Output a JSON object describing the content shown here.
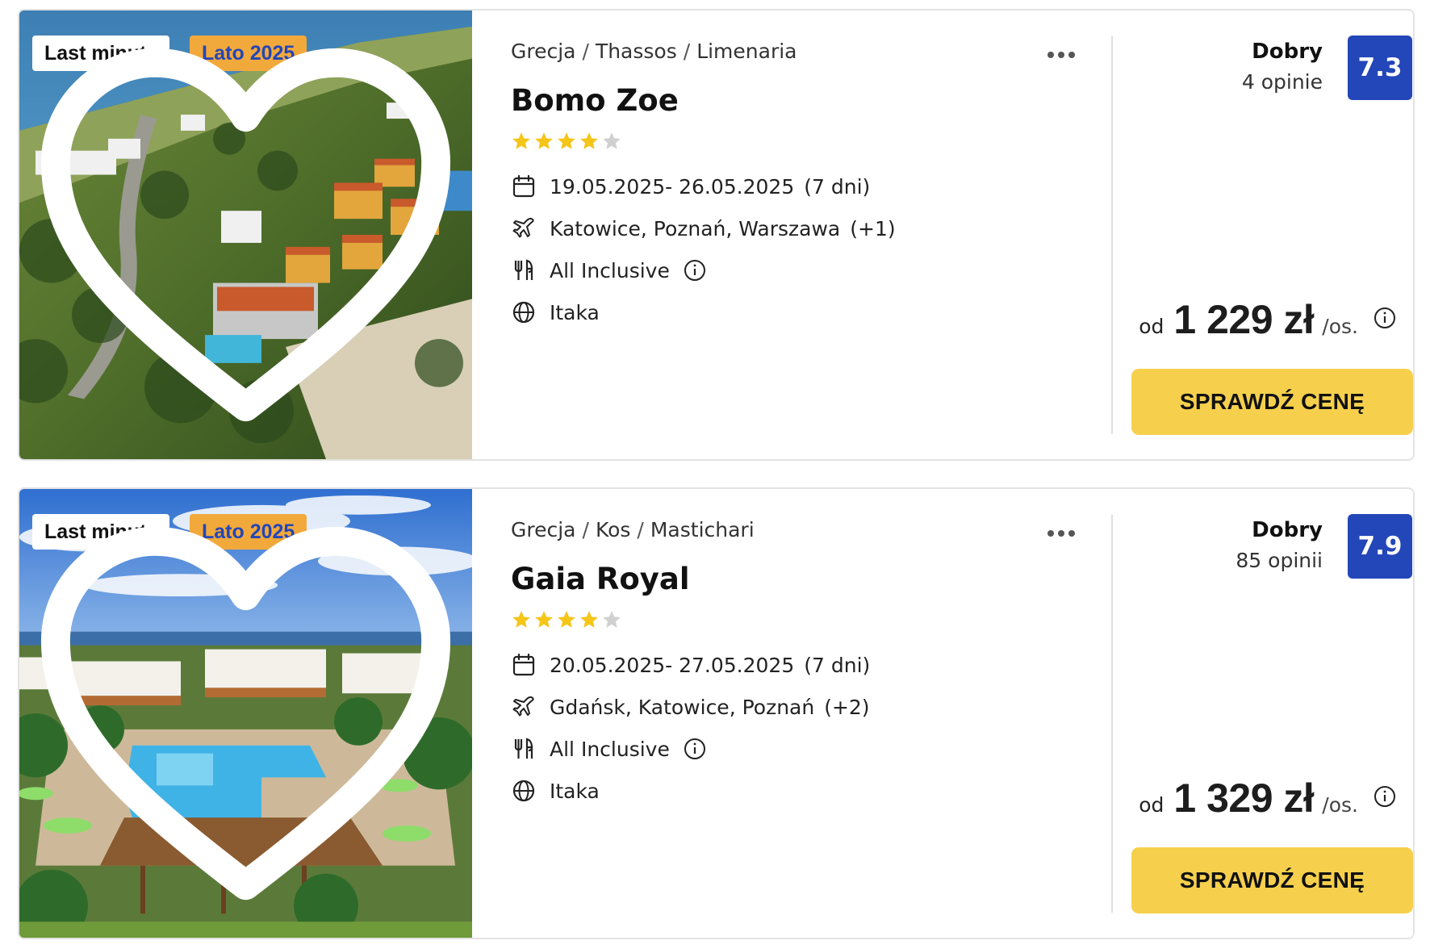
{
  "offers": [
    {
      "tags": {
        "last_minute": "Last minute",
        "season": "Lato 2025"
      },
      "breadcrumb": {
        "country": "Grecja",
        "region": "Thassos",
        "city": "Limenaria",
        "separator": "/"
      },
      "hotel_name": "Bomo Zoe",
      "stars": 4,
      "stars_max": 5,
      "dates": "19.05.2025- 26.05.2025",
      "duration": "(7 dni)",
      "departures": "Katowice, Poznań, Warszawa",
      "departures_more": "(+1)",
      "board": "All Inclusive",
      "operator": "Itaka",
      "rating": {
        "word": "Dobry",
        "count": "4 opinie",
        "score": "7.3"
      },
      "price": {
        "prefix": "od",
        "amount": "1 229 zł",
        "suffix": "/os."
      },
      "cta_label": "SPRAWDŹ CENĘ",
      "photo_icon": "aerial-hillside-resort-photo"
    },
    {
      "tags": {
        "last_minute": "Last minute",
        "season": "Lato 2025"
      },
      "breadcrumb": {
        "country": "Grecja",
        "region": "Kos",
        "city": "Mastichari",
        "separator": "/"
      },
      "hotel_name": "Gaia Royal",
      "stars": 4,
      "stars_max": 5,
      "dates": "20.05.2025- 27.05.2025",
      "duration": "(7 dni)",
      "departures": "Gdańsk, Katowice, Poznań",
      "departures_more": "(+2)",
      "board": "All Inclusive",
      "operator": "Itaka",
      "rating": {
        "word": "Dobry",
        "count": "85 opinii",
        "score": "7.9"
      },
      "price": {
        "prefix": "od",
        "amount": "1 329 zł",
        "suffix": "/os."
      },
      "cta_label": "SPRAWDŹ CENĘ",
      "photo_icon": "resort-pool-photo"
    }
  ],
  "colors": {
    "accent_blue": "#2346b8",
    "season_tag": "#f2a93b",
    "cta_yellow": "#f6d04d",
    "star_filled": "#f5c518",
    "star_empty": "#d0d0d0"
  }
}
